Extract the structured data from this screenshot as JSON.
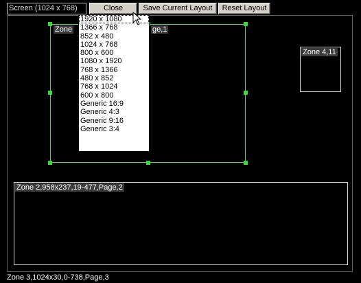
{
  "toolbar": {
    "screen_select": "Screen (1024 x 768)",
    "close_label": "Close",
    "save_label": "Save Current Layout",
    "reset_label": "Reset Layout"
  },
  "zones": {
    "zone1_label": "Zone 1,...,Page,1",
    "zone1_prefix": "Zone",
    "zone1_suffix": "ge,1",
    "zone4_label": "Zone 4,11",
    "zone2_label": "Zone 2,958x237,19-477,Page,2",
    "zone3_label": "Zone 3,1024x30,0-738,Page,3"
  },
  "resolution_options": [
    "1920 x 1080",
    "1366 x 768",
    "852 x 480",
    "1024 x 768",
    "800 x 600",
    "1080 x 1920",
    "768 x 1366",
    "480 x 852",
    "768 x 1024",
    "600 x 800",
    "Generic 16:9",
    "Generic 4:3",
    "Generic 9:16",
    "Generic 3:4"
  ],
  "colors": {
    "background": "#000000",
    "selection_handle": "#3cd83c",
    "zone_border": "#d8d8d8"
  }
}
